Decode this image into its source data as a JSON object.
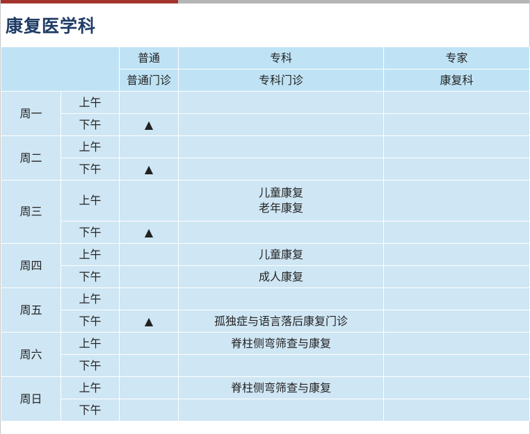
{
  "department_title": "康复医学科",
  "header": {
    "categories": [
      "普通",
      "专科",
      "专家"
    ],
    "subcategories": [
      "普通门诊",
      "专科门诊",
      "康复科"
    ]
  },
  "slots": {
    "am": "上午",
    "pm": "下午"
  },
  "marker": "▲",
  "days": [
    {
      "name": "周一",
      "am": {
        "general": "",
        "specialty": [],
        "expert": ""
      },
      "pm": {
        "general": "▲",
        "specialty": [],
        "expert": ""
      }
    },
    {
      "name": "周二",
      "am": {
        "general": "",
        "specialty": [],
        "expert": ""
      },
      "pm": {
        "general": "▲",
        "specialty": [],
        "expert": ""
      }
    },
    {
      "name": "周三",
      "am": {
        "general": "",
        "specialty": [
          "儿童康复",
          "老年康复"
        ],
        "expert": ""
      },
      "pm": {
        "general": "▲",
        "specialty": [],
        "expert": ""
      }
    },
    {
      "name": "周四",
      "am": {
        "general": "",
        "specialty": [
          "儿童康复"
        ],
        "expert": ""
      },
      "pm": {
        "general": "",
        "specialty": [
          "成人康复"
        ],
        "expert": ""
      }
    },
    {
      "name": "周五",
      "am": {
        "general": "",
        "specialty": [],
        "expert": ""
      },
      "pm": {
        "general": "▲",
        "specialty": [
          "孤独症与语言落后康复门诊"
        ],
        "expert": ""
      }
    },
    {
      "name": "周六",
      "am": {
        "general": "",
        "specialty": [
          "脊柱侧弯筛查与康复"
        ],
        "expert": ""
      },
      "pm": {
        "general": "",
        "specialty": [],
        "expert": ""
      }
    },
    {
      "name": "周日",
      "am": {
        "general": "",
        "specialty": [
          "脊柱侧弯筛查与康复"
        ],
        "expert": ""
      },
      "pm": {
        "general": "",
        "specialty": [],
        "expert": ""
      }
    }
  ],
  "colors": {
    "accent_bar": "#a4332e",
    "gray_bar": "#b5b5b5",
    "title_text": "#1f3c66",
    "header_bg": "#bfe3f5",
    "body_bg": "#cfe6f4",
    "grid_line": "#ffffff"
  }
}
